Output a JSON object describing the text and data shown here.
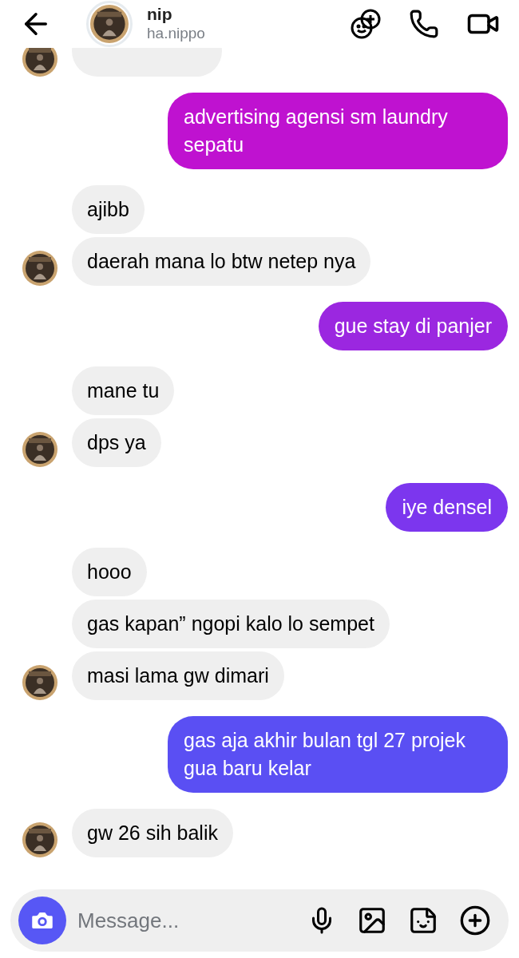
{
  "header": {
    "name": "nip",
    "username": "ha.nippo"
  },
  "groups": [
    {
      "kind": "partial"
    },
    {
      "kind": "sent",
      "messages": [
        {
          "text": "advertising agensi sm laundry sepatu",
          "color": "#bf12d0"
        }
      ]
    },
    {
      "kind": "received",
      "messages": [
        {
          "text": "ajibb"
        },
        {
          "text": "daerah mana lo btw netep nya"
        }
      ]
    },
    {
      "kind": "sent",
      "messages": [
        {
          "text": "gue stay di panjer",
          "color": "#9b27e0"
        }
      ]
    },
    {
      "kind": "received",
      "messages": [
        {
          "text": "mane tu"
        },
        {
          "text": "dps ya"
        }
      ]
    },
    {
      "kind": "sent",
      "messages": [
        {
          "text": "iye densel",
          "color": "#7c36ee"
        }
      ]
    },
    {
      "kind": "received",
      "messages": [
        {
          "text": "hooo"
        },
        {
          "text": "gas kapan” ngopi kalo lo sempet"
        },
        {
          "text": "masi lama gw dimari"
        }
      ]
    },
    {
      "kind": "sent",
      "messages": [
        {
          "text": "gas aja akhir bulan tgl 27 projek gua baru kelar",
          "color": "#5a4ff3"
        }
      ]
    },
    {
      "kind": "received",
      "messages": [
        {
          "text": "gw 26 sih balik"
        }
      ]
    }
  ],
  "composer": {
    "placeholder": "Message..."
  }
}
